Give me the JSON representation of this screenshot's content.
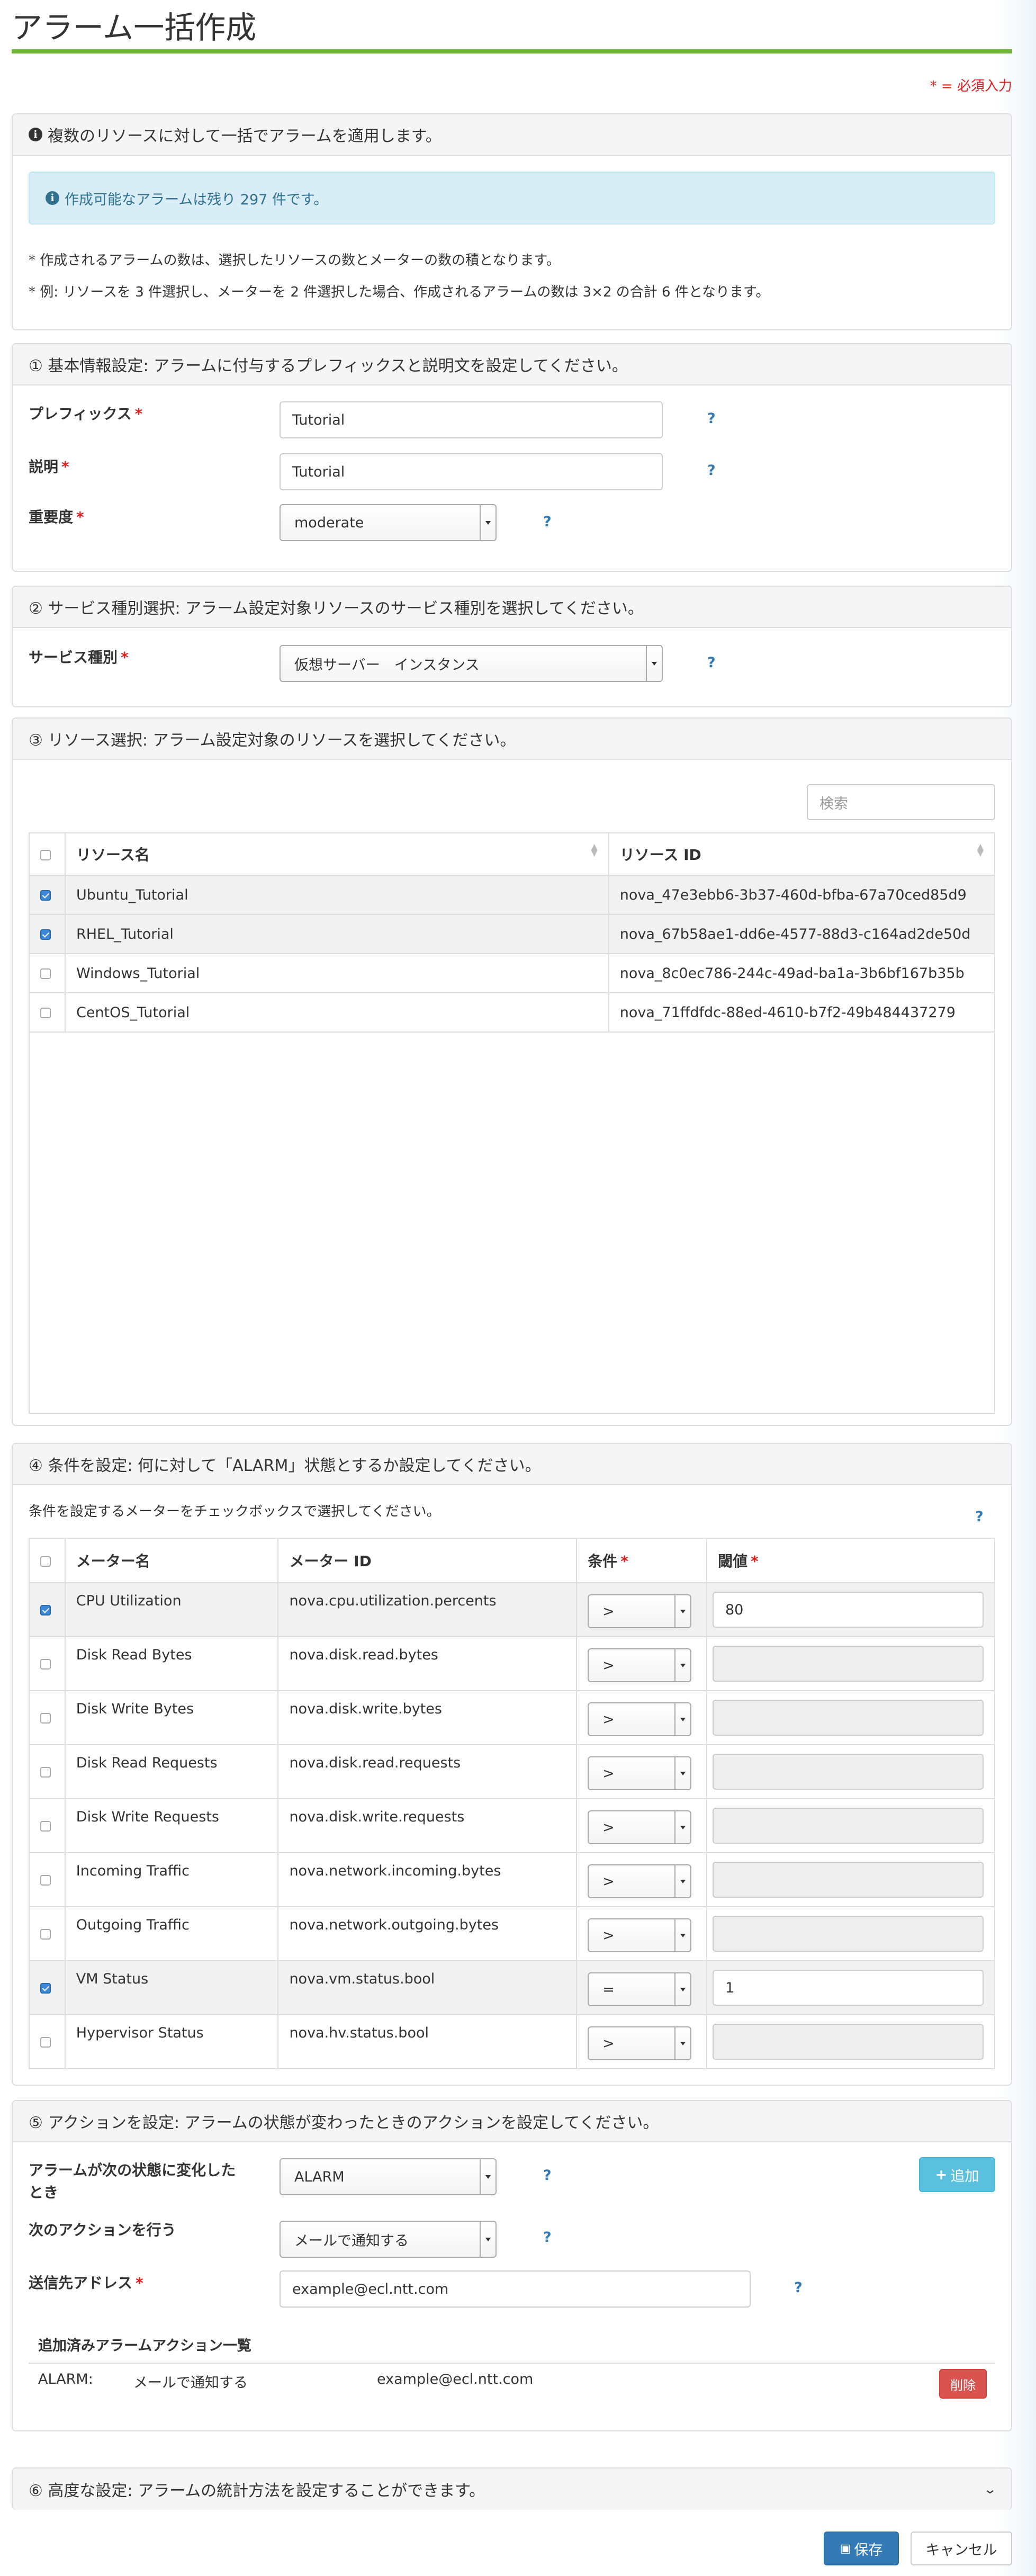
{
  "page": {
    "title": "アラーム一括作成",
    "required_note": "* = 必須入力"
  },
  "intro": {
    "heading": "複数のリソースに対して一括でアラームを適用します。",
    "alert": "作成可能なアラームは残り 297 件です。",
    "notes": [
      "* 作成されるアラームの数は、選択したリソースの数とメーターの数の積となります。",
      "* 例: リソースを 3 件選択し、メーターを 2 件選択した場合、作成されるアラームの数は 3×2 の合計 6 件となります。"
    ]
  },
  "basic": {
    "heading": "① 基本情報設定: アラームに付与するプレフィックスと説明文を設定してください。",
    "prefix_label": "プレフィックス",
    "prefix_value": "Tutorial",
    "desc_label": "説明",
    "desc_value": "Tutorial",
    "severity_label": "重要度",
    "severity_value": "moderate",
    "help": "?",
    "req": "*"
  },
  "service": {
    "heading": "② サービス種別選択: アラーム設定対象リソースのサービス種別を選択してください。",
    "label": "サービス種別",
    "value": "仮想サーバー　インスタンス"
  },
  "resources": {
    "heading": "③ リソース選択: アラーム設定対象のリソースを選択してください。",
    "search_placeholder": "検索",
    "col_name": "リソース名",
    "col_id": "リソース ID",
    "rows": [
      {
        "name": "Ubuntu_Tutorial",
        "id": "nova_47e3ebb6-3b37-460d-bfba-67a70ced85d9",
        "checked": true
      },
      {
        "name": "RHEL_Tutorial",
        "id": "nova_67b58ae1-dd6e-4577-88d3-c164ad2de50d",
        "checked": true
      },
      {
        "name": "Windows_Tutorial",
        "id": "nova_8c0ec786-244c-49ad-ba1a-3b6bf167b35b",
        "checked": false
      },
      {
        "name": "CentOS_Tutorial",
        "id": "nova_71ffdfdc-88ed-4610-b7f2-49b484437279",
        "checked": false
      }
    ]
  },
  "conditions": {
    "heading": "④ 条件を設定: 何に対して「ALARM」状態とするか設定してください。",
    "instruction": "条件を設定するメーターをチェックボックスで選択してください。",
    "col_meter": "メーター名",
    "col_id": "メーター ID",
    "col_cond": "条件",
    "col_threshold": "閾値",
    "rows": [
      {
        "name": "CPU Utilization",
        "id": "nova.cpu.utilization.percents",
        "op": ">",
        "threshold": "80",
        "checked": true
      },
      {
        "name": "Disk Read Bytes",
        "id": "nova.disk.read.bytes",
        "op": ">",
        "threshold": "",
        "checked": false
      },
      {
        "name": "Disk Write Bytes",
        "id": "nova.disk.write.bytes",
        "op": ">",
        "threshold": "",
        "checked": false
      },
      {
        "name": "Disk Read Requests",
        "id": "nova.disk.read.requests",
        "op": ">",
        "threshold": "",
        "checked": false
      },
      {
        "name": "Disk Write Requests",
        "id": "nova.disk.write.requests",
        "op": ">",
        "threshold": "",
        "checked": false
      },
      {
        "name": "Incoming Traffic",
        "id": "nova.network.incoming.bytes",
        "op": ">",
        "threshold": "",
        "checked": false
      },
      {
        "name": "Outgoing Traffic",
        "id": "nova.network.outgoing.bytes",
        "op": ">",
        "threshold": "",
        "checked": false
      },
      {
        "name": "VM Status",
        "id": "nova.vm.status.bool",
        "op": "=",
        "threshold": "1",
        "checked": true
      },
      {
        "name": "Hypervisor Status",
        "id": "nova.hv.status.bool",
        "op": ">",
        "threshold": "",
        "checked": false
      }
    ]
  },
  "actions": {
    "heading": "⑤ アクションを設定: アラームの状態が変わったときのアクションを設定してください。",
    "state_label_1": "アラームが次の状態に変化した",
    "state_label_2": "とき",
    "state_value": "ALARM",
    "add_button": "追加",
    "action_label": "次のアクションを行う",
    "action_value": "メールで通知する",
    "email_label": "送信先アドレス",
    "email_value": "example@ecl.ntt.com",
    "list_heading": "追加済みアラームアクション一覧",
    "list": [
      {
        "state": "ALARM:",
        "action": "メールで通知する",
        "target": "example@ecl.ntt.com",
        "delete": "削除"
      }
    ]
  },
  "advanced": {
    "heading": "⑥ 高度な設定: アラームの統計方法を設定することができます。"
  },
  "footer": {
    "save": "保存",
    "cancel": "キャンセル"
  },
  "colors": {
    "accent_green": "#6fb53a",
    "primary": "#337ab7",
    "info": "#5bc0de",
    "danger": "#d9534f",
    "required": "#e02020"
  },
  "icons": [
    "info-circle-icon",
    "plus-icon",
    "save-icon",
    "chevron-down-double-icon",
    "sort-icon",
    "checkbox-icon",
    "select-caret-icon"
  ]
}
